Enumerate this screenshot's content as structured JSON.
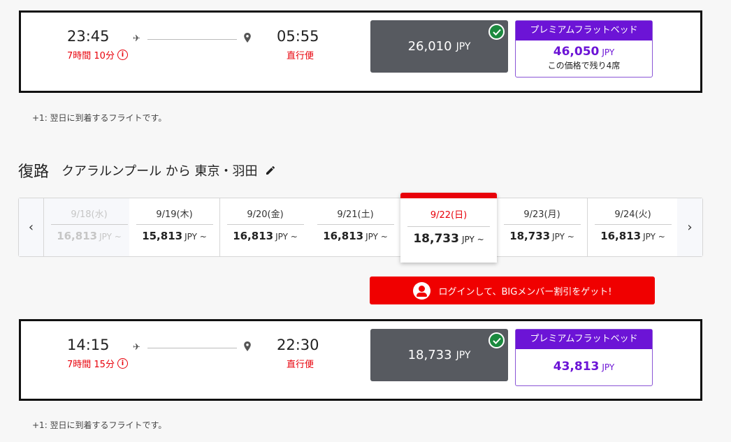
{
  "outbound": {
    "departure_time": "23:45",
    "arrival_time": "05:55",
    "duration": "7時間 10分",
    "flight_type": "直行便",
    "standard_price": "26,010",
    "standard_currency": "JPY",
    "premium_label": "プレミアムフラットベッド",
    "premium_price": "46,050",
    "premium_currency": "JPY",
    "premium_seats": "この価格で残り4席",
    "note": "+1: 翌日に到着するフライトです。"
  },
  "return_section": {
    "title": "復路",
    "route": "クアラルンプール から 東京・羽田"
  },
  "date_selector": {
    "days": [
      {
        "date": "9/18(水)",
        "price": "16,813",
        "currency": "JPY ~"
      },
      {
        "date": "9/19(木)",
        "price": "15,813",
        "currency": "JPY ~"
      },
      {
        "date": "9/20(金)",
        "price": "16,813",
        "currency": "JPY ~"
      },
      {
        "date": "9/21(土)",
        "price": "16,813",
        "currency": "JPY ~"
      },
      {
        "date": "9/22(日)",
        "price": "18,733",
        "currency": "JPY ~"
      },
      {
        "date": "9/23(月)",
        "price": "18,733",
        "currency": "JPY ~"
      },
      {
        "date": "9/24(火)",
        "price": "16,813",
        "currency": "JPY ~"
      }
    ]
  },
  "login_banner": {
    "label": "ログインして、BIGメンバー割引をゲット!"
  },
  "return_flight": {
    "departure_time": "14:15",
    "arrival_time": "22:30",
    "duration": "7時間 15分",
    "flight_type": "直行便",
    "standard_price": "18,733",
    "standard_currency": "JPY",
    "premium_label": "プレミアムフラットベッド",
    "premium_price": "43,813",
    "premium_currency": "JPY",
    "note": "+1: 翌日に到着するフライトです。"
  },
  "colors": {
    "accent_red": "#e8000a",
    "premium_purple": "#6c14d6",
    "selected_dark": "#575a60",
    "check_green": "#1b8a3e"
  }
}
